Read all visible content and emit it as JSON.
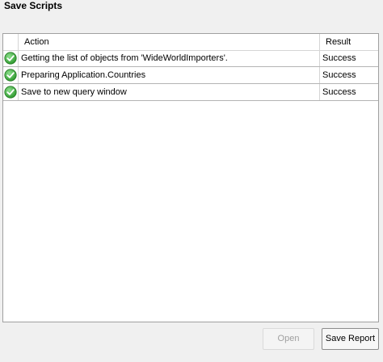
{
  "window": {
    "title": "Save Scripts"
  },
  "grid": {
    "columns": {
      "action": "Action",
      "result": "Result"
    },
    "rows": [
      {
        "status_icon": "success-check-icon",
        "action": "Getting the list of objects from 'WideWorldImporters'.",
        "result": "Success"
      },
      {
        "status_icon": "success-check-icon",
        "action": "Preparing Application.Countries",
        "result": "Success"
      },
      {
        "status_icon": "success-check-icon",
        "action": "Save to new query window",
        "result": "Success"
      }
    ]
  },
  "buttons": {
    "open": "Open",
    "save_report": "Save Report"
  },
  "colors": {
    "success_green": "#3aa53a",
    "grid_border": "#a0a0a0",
    "background": "#f0f0f0"
  }
}
